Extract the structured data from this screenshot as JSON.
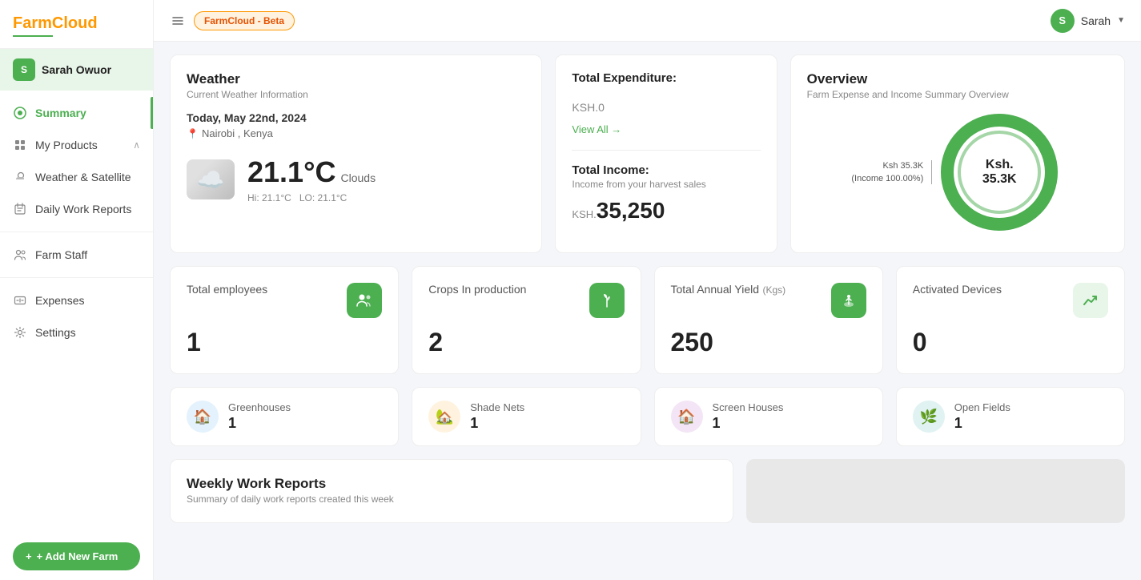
{
  "app": {
    "name": "FarmCloud",
    "name_highlight": "Farm",
    "name_color": "Cloud",
    "badge": "FarmCloud - Beta"
  },
  "user": {
    "name": "Sarah Owuor",
    "initial": "S",
    "display_name": "Sarah"
  },
  "sidebar": {
    "items": [
      {
        "id": "summary",
        "label": "Summary",
        "icon": "⊙",
        "active": true
      },
      {
        "id": "products",
        "label": "My Products",
        "icon": "📦",
        "active": false,
        "arrow": true
      },
      {
        "id": "weather",
        "label": "Weather & Satellite",
        "icon": "🌤",
        "active": false
      },
      {
        "id": "daily",
        "label": "Daily Work Reports",
        "icon": "📋",
        "active": false
      },
      {
        "id": "farmstaff",
        "label": "Farm Staff",
        "icon": "👥",
        "active": false
      },
      {
        "id": "expenses",
        "label": "Expenses",
        "icon": "💳",
        "active": false
      },
      {
        "id": "settings",
        "label": "Settings",
        "icon": "⚙",
        "active": false
      }
    ],
    "add_farm_label": "+ Add New Farm"
  },
  "weather": {
    "title": "Weather",
    "subtitle": "Current Weather Information",
    "date": "Today, May 22nd, 2024",
    "location": "Nairobi , Kenya",
    "temperature": "21.1°C",
    "temp_raw": "21.1",
    "condition": "Clouds",
    "hi": "Hi: 21.1°C",
    "lo": "LO: 21.1°C"
  },
  "finance": {
    "expenditure_label": "Total Expenditure:",
    "expenditure_prefix": "KSH.",
    "expenditure_value": "0",
    "view_all": "View All →",
    "income_label": "Total Income:",
    "income_sub": "Income from your harvest sales",
    "income_prefix": "KSH.",
    "income_value": "35,250"
  },
  "overview": {
    "title": "Overview",
    "subtitle": "Farm Expense and Income Summary Overview",
    "donut_label": "Ksh 35.3K",
    "donut_label2": "come 100.00%)",
    "donut_center": "Ksh. 35.3K",
    "donut_value": 100,
    "color": "#4caf50"
  },
  "stats": [
    {
      "id": "employees",
      "label": "Total employees",
      "value": "1",
      "icon": "👥",
      "icon_type": "people"
    },
    {
      "id": "crops",
      "label": "Crops In production",
      "value": "2",
      "icon": "🌱",
      "icon_type": "plant"
    },
    {
      "id": "yield",
      "label": "Total Annual Yield",
      "label_small": "(Kgs)",
      "value": "250",
      "icon": "🌾",
      "icon_type": "yield"
    },
    {
      "id": "devices",
      "label": "Activated Devices",
      "value": "0",
      "icon": "📈",
      "icon_type": "chart"
    }
  ],
  "locations": [
    {
      "id": "greenhouses",
      "label": "Greenhouses",
      "value": "1",
      "icon": "🏠",
      "color": "greenhouse"
    },
    {
      "id": "shade",
      "label": "Shade Nets",
      "value": "1",
      "icon": "🏡",
      "color": "shade"
    },
    {
      "id": "screen",
      "label": "Screen Houses",
      "value": "1",
      "icon": "🏠",
      "color": "screen"
    },
    {
      "id": "open",
      "label": "Open Fields",
      "value": "1",
      "icon": "🌿",
      "color": "open"
    }
  ],
  "weekly": {
    "title": "Weekly Work Reports",
    "subtitle": "Summary of daily work reports created this week"
  }
}
